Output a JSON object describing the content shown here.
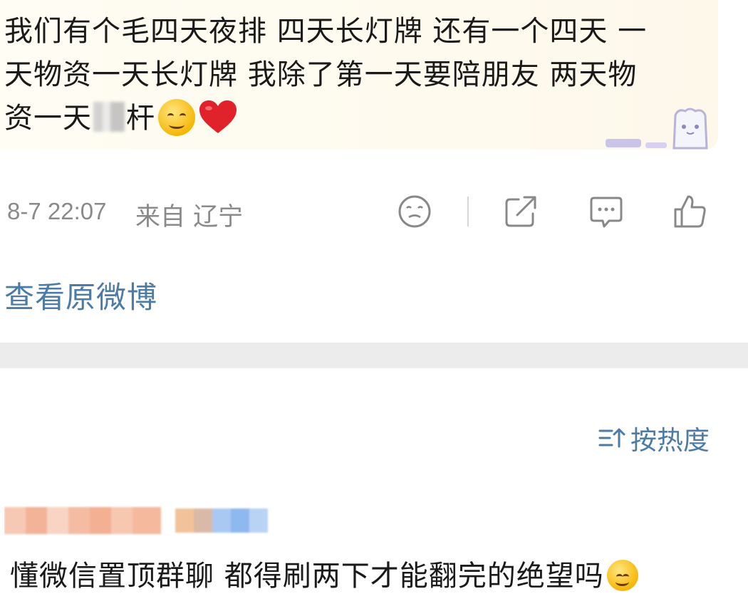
{
  "post": {
    "line1": "我们有个毛四天夜排 四天长灯牌 还有一个四天 一",
    "line2": "天物资一天长灯牌 我除了第一天要陪朋友 两天物",
    "line3_prefix": "资一天",
    "line3_suffix": "杆",
    "emoji1": "smiling-face-emoji",
    "emoji2": "red-heart-emoji"
  },
  "meta": {
    "time": "8-7 22:07",
    "location": "来自 辽宁"
  },
  "actions": {
    "icons": [
      "sad-face-icon",
      "share-icon",
      "comment-icon",
      "like-icon"
    ]
  },
  "view_original": "查看原微博",
  "sort": {
    "label": "按热度",
    "icon": "sort-icon"
  },
  "comment": {
    "text": "懂微信置顶群聊 都得刷两下才能翻完的绝望吗",
    "emoji": "smiling-face-emoji"
  },
  "colors": {
    "link": "#4b7ba6",
    "meta": "#8a8a8a",
    "heart": "#e0222a",
    "band": "#ececec"
  }
}
